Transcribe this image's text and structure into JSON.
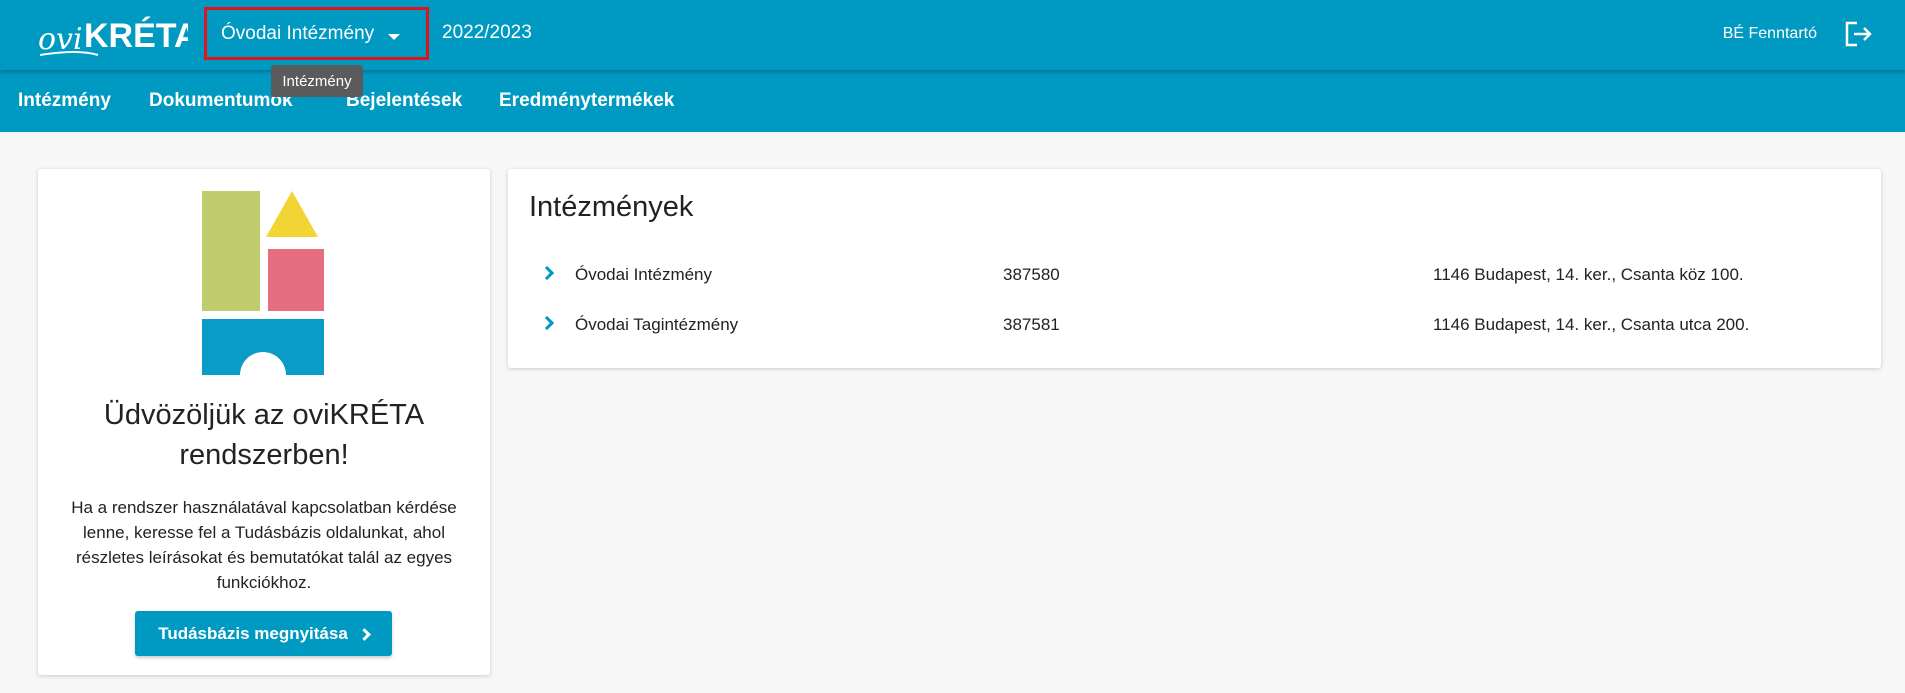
{
  "header": {
    "logo_text": "oviKRÉTA",
    "institution": "Óvodai Intézmény",
    "year": "2022/2023",
    "user": "BÉ Fenntartó",
    "logout_icon": "logout-icon"
  },
  "nav": {
    "items": [
      {
        "label": "Intézmény"
      },
      {
        "label": "Dokumentumok"
      },
      {
        "label": "Bejelentések"
      },
      {
        "label": "Eredménytermékek"
      }
    ]
  },
  "tooltip": "Intézmény",
  "welcome": {
    "title": "Üdvözöljük az oviKRÉTA rendszerben!",
    "text": "Ha a rendszer használatával kapcsolatban kérdése lenne, keresse fel a Tudásbázis oldalunkat, ahol részletes leírásokat és bemutatókat talál az egyes funkciókhoz.",
    "button": "Tudásbázis megnyitása"
  },
  "institutions": {
    "title": "Intézmények",
    "rows": [
      {
        "name": "Óvodai Intézmény",
        "code": "387580",
        "address": "1146 Budapest, 14. ker., Csanta köz 100."
      },
      {
        "name": "Óvodai Tagintézmény",
        "code": "387581",
        "address": "1146 Budapest, 14. ker., Csanta utca 200."
      }
    ]
  },
  "colors": {
    "primary": "#0099c2",
    "highlight": "#e0141e",
    "block_green": "#bfcd6e",
    "block_yellow": "#f2d535",
    "block_pink": "#e66e80",
    "block_blue": "#0a9bc6"
  }
}
